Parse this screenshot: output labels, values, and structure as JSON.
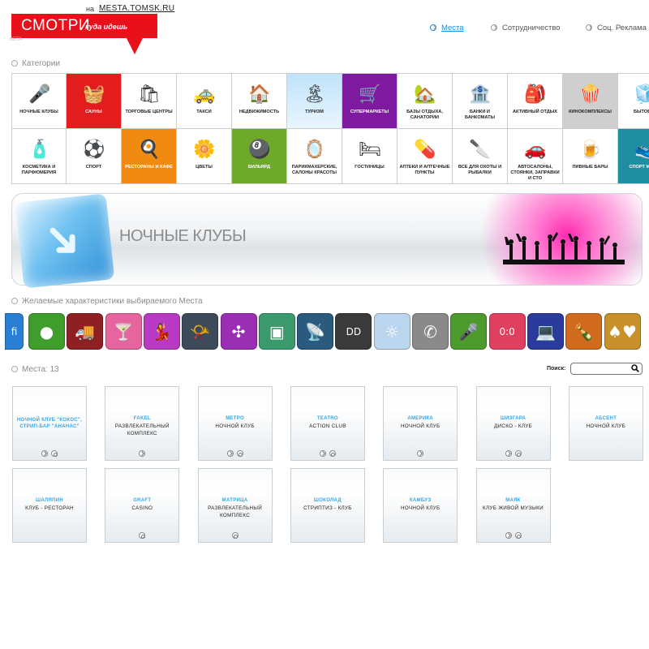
{
  "header": {
    "logo_main": "СМОТРИ",
    "logo_sub": "куда идешь",
    "logo_beta": "BETA",
    "domain_prefix": "на",
    "domain": "MESTA.TOMSK.RU",
    "nav": [
      "Места",
      "Сотрудничество",
      "Соц. Реклама"
    ],
    "active_nav": "Места",
    "link_color": "#1a8ad4",
    "brand_color": "#e8101b"
  },
  "categories_title": "Категории",
  "categories": [
    {
      "label": "Ночные клубы",
      "icon": "microphone-icon",
      "glyph": "🎤",
      "bg": "white"
    },
    {
      "label": "Сауны",
      "icon": "soap-basket-icon",
      "glyph": "🧺",
      "bg": "red"
    },
    {
      "label": "Торговые центры",
      "icon": "shopping-bag-icon",
      "glyph": "🛍",
      "bg": "white"
    },
    {
      "label": "Такси",
      "icon": "taxi-icon",
      "glyph": "🚕",
      "bg": "white"
    },
    {
      "label": "Недвижимость",
      "icon": "house-icon",
      "glyph": "🏠",
      "bg": "white"
    },
    {
      "label": "Туризм",
      "icon": "palm-island-icon",
      "glyph": "🏝",
      "bg": "sky"
    },
    {
      "label": "Супермаркеты",
      "icon": "shopping-cart-icon",
      "glyph": "🛒",
      "bg": "purple"
    },
    {
      "label": "Базы отдыха, санатории",
      "icon": "cabin-icon",
      "glyph": "🏡",
      "bg": "white"
    },
    {
      "label": "Банки и банкоматы",
      "icon": "safe-icon",
      "glyph": "🏦",
      "bg": "white"
    },
    {
      "label": "Активный отдых",
      "icon": "backpack-icon",
      "glyph": "🎒",
      "bg": "white"
    },
    {
      "label": "Кинокомплексы",
      "icon": "popcorn-icon",
      "glyph": "🍿",
      "bg": "grey"
    },
    {
      "label": "Бытовая",
      "icon": "appliance-icon",
      "glyph": "🧊",
      "bg": "white"
    },
    {
      "label": "Косметика и парфюмерия",
      "icon": "perfume-icon",
      "glyph": "🧴",
      "bg": "white"
    },
    {
      "label": "Спорт",
      "icon": "sport-ball-icon",
      "glyph": "⚽",
      "bg": "white"
    },
    {
      "label": "Рестораны и кафе",
      "icon": "chef-icon",
      "glyph": "🍳",
      "bg": "orange"
    },
    {
      "label": "Цветы",
      "icon": "flower-icon",
      "glyph": "🌼",
      "bg": "white"
    },
    {
      "label": "Бильярд",
      "icon": "billiard-ball-icon",
      "glyph": "🎱",
      "bg": "green"
    },
    {
      "label": "Парикмахерские, салоны красоты",
      "icon": "mirror-icon",
      "glyph": "🪞",
      "bg": "white"
    },
    {
      "label": "Гостиницы",
      "icon": "hotel-icon",
      "glyph": "🛏",
      "bg": "white"
    },
    {
      "label": "Аптеки и аптечные пункты",
      "icon": "pill-icon",
      "glyph": "💊",
      "bg": "white"
    },
    {
      "label": "Все для охоты и рыбалки",
      "icon": "knife-icon",
      "glyph": "🔪",
      "bg": "white"
    },
    {
      "label": "Автосалоны, стоянки, заправки и СТО",
      "icon": "car-icon",
      "glyph": "🚗",
      "bg": "white"
    },
    {
      "label": "Пивные бары",
      "icon": "beer-icon",
      "glyph": "🍺",
      "bg": "white"
    },
    {
      "label": "Спорт магаз",
      "icon": "sport-store-icon",
      "glyph": "👟",
      "bg": "teal"
    }
  ],
  "banner": {
    "title": "НОЧНЫЕ КЛУБЫ",
    "accent_color": "#ff2bb0"
  },
  "features_title": "Желаемые характеристики выбираемого Места",
  "features": [
    {
      "icon": "wifi-icon",
      "glyph": "fi",
      "color": "#2a7fd4"
    },
    {
      "icon": "billiard-balls-icon",
      "glyph": "●",
      "color": "#3f9d2b"
    },
    {
      "icon": "truck-icon",
      "glyph": "🚚",
      "color": "#8e2023"
    },
    {
      "icon": "cocktail-icon",
      "glyph": "🍸",
      "color": "#e6659f"
    },
    {
      "icon": "dancer-icon",
      "glyph": "💃",
      "color": "#b83ac2"
    },
    {
      "icon": "horn-icon",
      "glyph": "📯",
      "color": "#3d4a5a"
    },
    {
      "icon": "fan-icon",
      "glyph": "✣",
      "color": "#9a2fb3"
    },
    {
      "icon": "speaker-icon",
      "glyph": "▣",
      "color": "#3b9a6d"
    },
    {
      "icon": "satellite-dish-icon",
      "glyph": "📡",
      "color": "#2a5a7e"
    },
    {
      "icon": "dolby-icon",
      "glyph": "DD",
      "color": "#3a3a3a"
    },
    {
      "icon": "sun-icon",
      "glyph": "☼",
      "color": "#bcd6ef"
    },
    {
      "icon": "phone-icon",
      "glyph": "✆",
      "color": "#8a8a8a"
    },
    {
      "icon": "karaoke-mic-icon",
      "glyph": "🎤",
      "color": "#4e9b2d"
    },
    {
      "icon": "counter-icon",
      "glyph": "0:0",
      "color": "#e0405f"
    },
    {
      "icon": "laptop-icon",
      "glyph": "💻",
      "color": "#2a3b9b"
    },
    {
      "icon": "bottle-icon",
      "glyph": "🍾",
      "color": "#d06a1c"
    },
    {
      "icon": "card-suits-icon",
      "glyph": "♠♥",
      "color": "#c7902a"
    }
  ],
  "places_title": "Места: 13",
  "search": {
    "label": "Поиск:",
    "placeholder": ""
  },
  "places": [
    {
      "name": "ночной клуб \"кокос\", стрип-бар \"ананас\"",
      "desc": "",
      "buttons": [
        "arrow",
        "at"
      ]
    },
    {
      "name": "Fakel",
      "desc": "развлекательный комплекс",
      "buttons": [
        "arrow"
      ]
    },
    {
      "name": "Метро",
      "desc": "ночной клуб",
      "buttons": [
        "arrow",
        "at"
      ]
    },
    {
      "name": "Teatro",
      "desc": "Action Club",
      "buttons": [
        "arrow",
        "at"
      ]
    },
    {
      "name": "Америка",
      "desc": "ночной клуб",
      "buttons": [
        "arrow"
      ]
    },
    {
      "name": "Шизгара",
      "desc": "диско - клуб",
      "buttons": [
        "arrow",
        "at"
      ]
    },
    {
      "name": "Абсент",
      "desc": "ночной клуб",
      "buttons": []
    },
    {
      "name": "Шаляпин",
      "desc": "клуб - ресторан",
      "buttons": []
    },
    {
      "name": "Graft",
      "desc": "casino",
      "buttons": [
        "at"
      ]
    },
    {
      "name": "Матрица",
      "desc": "развлекательный комплекс",
      "buttons": [
        "at"
      ]
    },
    {
      "name": "Шоколад",
      "desc": "стриптиз - клуб",
      "buttons": []
    },
    {
      "name": "Камбуз",
      "desc": "ночной клуб",
      "buttons": []
    },
    {
      "name": "Маяк",
      "desc": "клуб живой музыки",
      "buttons": [
        "arrow",
        "at"
      ]
    }
  ]
}
